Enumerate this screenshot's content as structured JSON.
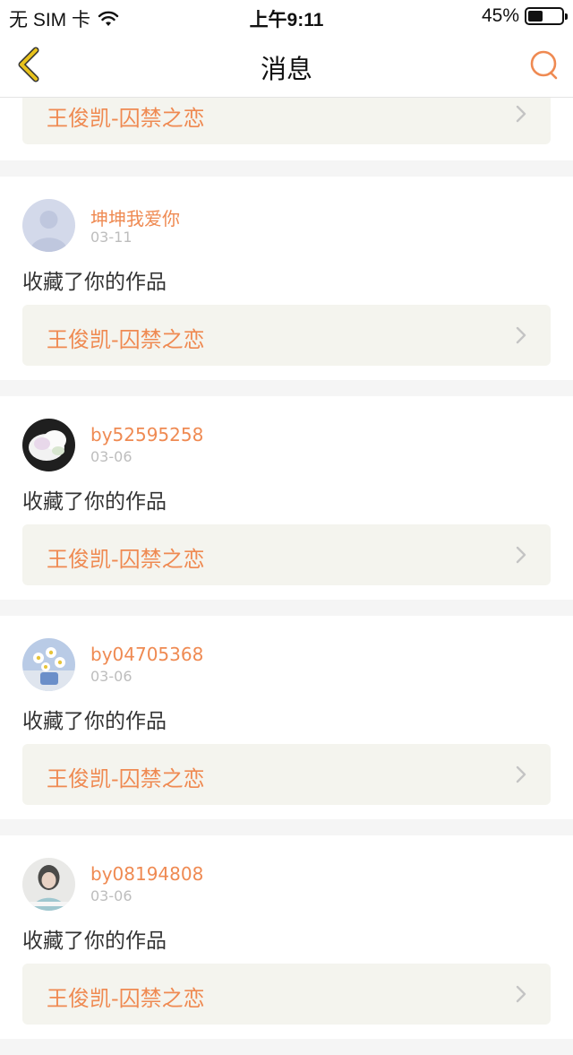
{
  "status_bar": {
    "carrier": "无 SIM 卡",
    "time": "上午9:11",
    "battery": "45%",
    "battery_level": 0.45
  },
  "nav": {
    "title": "消息",
    "back_icon": "chevron-left-icon",
    "search_icon": "search-icon"
  },
  "colors": {
    "accent": "#ef8a52",
    "back_icon": "#e8c21c",
    "card_bg": "#ffffff",
    "link_bg": "#f4f4ee",
    "page_bg": "#f5f5f5"
  },
  "partial_item": {
    "work_title": "王俊凯-囚禁之恋"
  },
  "messages": [
    {
      "username": "坤坤我爱你",
      "date": "03-11",
      "action": "收藏了你的作品",
      "work_title": "王俊凯-囚禁之恋",
      "avatar": "default-avatar"
    },
    {
      "username": "by52595258",
      "date": "03-06",
      "action": "收藏了你的作品",
      "work_title": "王俊凯-囚禁之恋",
      "avatar": "flower-photo-avatar"
    },
    {
      "username": "by04705368",
      "date": "03-06",
      "action": "收藏了你的作品",
      "work_title": "王俊凯-囚禁之恋",
      "avatar": "daisy-photo-avatar"
    },
    {
      "username": "by08194808",
      "date": "03-06",
      "action": "收藏了你的作品",
      "work_title": "王俊凯-囚禁之恋",
      "avatar": "portrait-photo-avatar"
    }
  ]
}
